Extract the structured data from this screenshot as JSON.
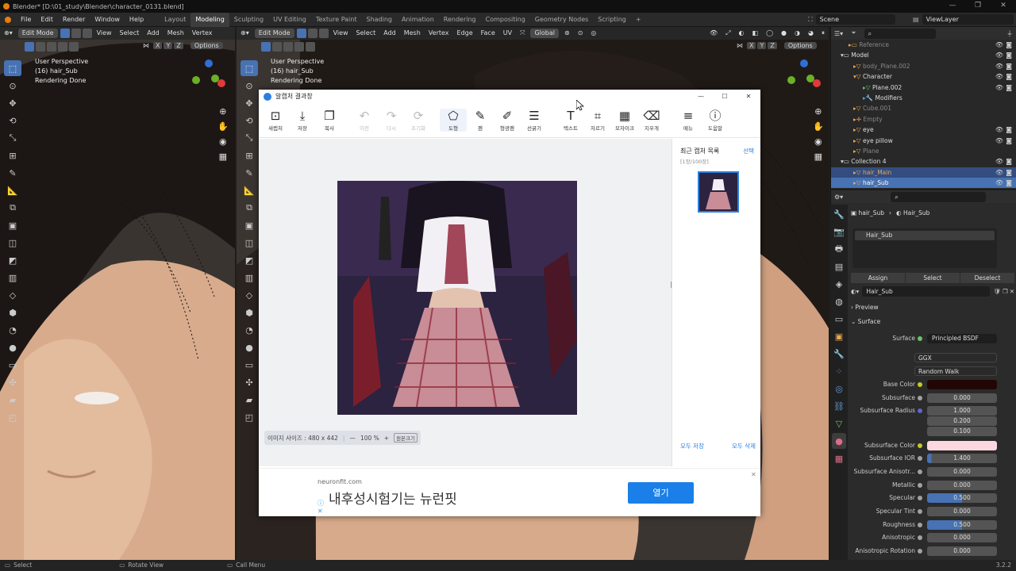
{
  "title_bar": {
    "text": "Blender* [D:\\01_study\\Blender\\character_0131.blend]"
  },
  "menu": {
    "items": [
      "File",
      "Edit",
      "Render",
      "Window",
      "Help"
    ]
  },
  "workspaces": [
    "Layout",
    "Modeling",
    "Sculpting",
    "UV Editing",
    "Texture Paint",
    "Shading",
    "Animation",
    "Rendering",
    "Compositing",
    "Geometry Nodes",
    "Scripting"
  ],
  "workspace_add": "+",
  "scene": {
    "label": "Scene",
    "view_layer": "ViewLayer"
  },
  "viewport_left": {
    "mode": "Edit Mode",
    "menus": [
      "View",
      "Select",
      "Add",
      "Mesh",
      "Vertex"
    ],
    "axes": [
      "X",
      "Y",
      "Z"
    ],
    "options": "Options",
    "info": [
      "User Perspective",
      "(16) hair_Sub",
      "Rendering Done"
    ]
  },
  "viewport_right": {
    "mode": "Edit Mode",
    "menus": [
      "View",
      "Select",
      "Add",
      "Mesh",
      "Vertex",
      "Edge",
      "Face",
      "UV"
    ],
    "transform": "Global",
    "axes": [
      "X",
      "Y",
      "Z"
    ],
    "options": "Options",
    "info": [
      "User Perspective",
      "(16) hair_Sub",
      "Rendering Done"
    ]
  },
  "outliner": {
    "rows": [
      {
        "name": "Reference",
        "dim": true
      },
      {
        "name": "Model",
        "dim": false
      },
      {
        "name": "body_Plane.002",
        "dim": true
      },
      {
        "name": "Character",
        "dim": false
      },
      {
        "name": "Plane.002",
        "dim": false
      },
      {
        "name": "Modifiers",
        "dim": false
      },
      {
        "name": "Cube.001",
        "dim": true
      },
      {
        "name": "Empty",
        "dim": true
      },
      {
        "name": "eye",
        "dim": false
      },
      {
        "name": "eye pillow",
        "dim": false
      },
      {
        "name": "Plane",
        "dim": true
      },
      {
        "name": "Collection 4",
        "dim": false
      },
      {
        "name": "hair_Main",
        "dim": false
      },
      {
        "name": "hair_Sub",
        "dim": false
      }
    ]
  },
  "properties": {
    "breadcrumb_object": "hair_Sub",
    "breadcrumb_material": "Hair_Sub",
    "slot": "Hair_Sub",
    "assign": "Assign",
    "select": "Select",
    "deselect": "Deselect",
    "material_name": "Hair_Sub",
    "preview": "Preview",
    "surface_panel": "Surface",
    "surface_label": "Surface",
    "surface_value": "Principled BSDF",
    "distribution": "GGX",
    "subsurface_method": "Random Walk",
    "fields": [
      {
        "label": "Base Color",
        "value": "",
        "kind": "color",
        "color": "#220606",
        "dot": "#c7c729"
      },
      {
        "label": "Subsurface",
        "value": "0.000",
        "kind": "num",
        "dot": "#a1a1a1"
      },
      {
        "label": "Subsurface Radius",
        "value": "1.000",
        "kind": "num",
        "dot": "#6363c7"
      },
      {
        "label": "",
        "value": "0.200",
        "kind": "num",
        "dot": ""
      },
      {
        "label": "",
        "value": "0.100",
        "kind": "num",
        "dot": ""
      },
      {
        "label": "Subsurface Color",
        "value": "",
        "kind": "color",
        "color": "#fbd8e0",
        "dot": "#c7c729"
      },
      {
        "label": "Subsurface IOR",
        "value": "1.400",
        "kind": "num",
        "dot": "#a1a1a1"
      },
      {
        "label": "Subsurface Anisotr...",
        "value": "0.000",
        "kind": "num",
        "dot": "#a1a1a1"
      },
      {
        "label": "Metallic",
        "value": "0.000",
        "kind": "num",
        "dot": "#a1a1a1"
      },
      {
        "label": "Specular",
        "value": "0.500",
        "kind": "bar",
        "dot": "#a1a1a1"
      },
      {
        "label": "Specular Tint",
        "value": "0.000",
        "kind": "num",
        "dot": "#a1a1a1"
      },
      {
        "label": "Roughness",
        "value": "0.500",
        "kind": "bar",
        "dot": "#a1a1a1"
      },
      {
        "label": "Anisotropic",
        "value": "0.000",
        "kind": "num",
        "dot": "#a1a1a1"
      },
      {
        "label": "Anisotropic Rotation",
        "value": "0.000",
        "kind": "num",
        "dot": "#a1a1a1"
      }
    ]
  },
  "capture": {
    "window_title": "알캡처 결과창",
    "tools": [
      {
        "label": "새캡처",
        "icon": "⊡",
        "name": "new-capture",
        "dis": false,
        "on": false
      },
      {
        "label": "저장",
        "icon": "⤓",
        "name": "save",
        "dis": false,
        "on": false
      },
      {
        "label": "복사",
        "icon": "❐",
        "name": "copy",
        "dis": false,
        "on": false
      },
      {
        "label": "이전",
        "icon": "↶",
        "name": "undo",
        "dis": true,
        "on": false
      },
      {
        "label": "다시",
        "icon": "↷",
        "name": "redo",
        "dis": true,
        "on": false
      },
      {
        "label": "초기화",
        "icon": "⟳",
        "name": "reset",
        "dis": true,
        "on": false
      },
      {
        "label": "도형",
        "icon": "⬠",
        "name": "shape",
        "dis": false,
        "on": true
      },
      {
        "label": "펜",
        "icon": "✎",
        "name": "pen",
        "dis": false,
        "on": false
      },
      {
        "label": "형광펜",
        "icon": "✐",
        "name": "highlighter",
        "dis": false,
        "on": false
      },
      {
        "label": "선굵기",
        "icon": "☰",
        "name": "line-width",
        "dis": false,
        "on": false
      },
      {
        "label": "텍스트",
        "icon": "T",
        "name": "text",
        "dis": false,
        "on": false
      },
      {
        "label": "자르기",
        "icon": "⌗",
        "name": "crop",
        "dis": false,
        "on": false
      },
      {
        "label": "모자이크",
        "icon": "▦",
        "name": "mosaic",
        "dis": false,
        "on": false
      },
      {
        "label": "지우개",
        "icon": "⌫",
        "name": "eraser",
        "dis": false,
        "on": false
      },
      {
        "label": "메뉴",
        "icon": "≡",
        "name": "menu",
        "dis": false,
        "on": false
      },
      {
        "label": "도움말",
        "icon": "ⓘ",
        "name": "help",
        "dis": false,
        "on": false
      }
    ],
    "recent_title": "최근 캡처 목록",
    "recent_count": "[1장/100장]",
    "select": "선택",
    "image_size": "이미지 사이즈 : 480 x 442",
    "zoom": "100 %",
    "zoom_minus": "—",
    "zoom_plus": "+",
    "original_size": "원본크기",
    "save_all": "모두 저장",
    "delete_all": "모두 삭제",
    "ad_domain": "neuronfit.com",
    "ad_text": "내후성시험기는 뉴런핏",
    "ad_button": "열기",
    "ad_close": "✕"
  },
  "statusbar": {
    "select": "Select",
    "rotate": "Rotate View",
    "call": "Call Menu",
    "version": "3.2.2"
  },
  "colors": {
    "accent": "#4772b3",
    "orange": "#e87d0d",
    "ad_button": "#1a7fe8"
  }
}
